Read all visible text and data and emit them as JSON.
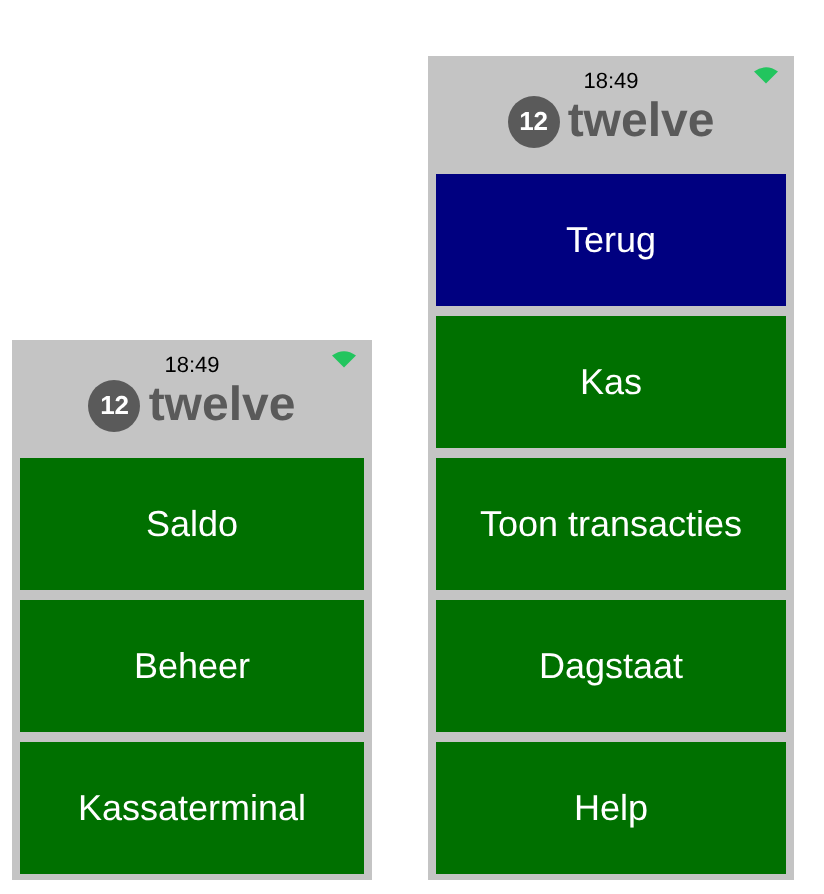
{
  "screens": [
    {
      "time": "18:49",
      "logo_mark": "12",
      "logo_text": "twelve",
      "buttons": [
        {
          "label": "Saldo",
          "kind": "menu"
        },
        {
          "label": "Beheer",
          "kind": "menu"
        },
        {
          "label": "Kassaterminal",
          "kind": "menu"
        }
      ]
    },
    {
      "time": "18:49",
      "logo_mark": "12",
      "logo_text": "twelve",
      "buttons": [
        {
          "label": "Terug",
          "kind": "back"
        },
        {
          "label": "Kas",
          "kind": "menu"
        },
        {
          "label": "Toon transacties",
          "kind": "menu"
        },
        {
          "label": "Dagstaat",
          "kind": "menu"
        },
        {
          "label": "Help",
          "kind": "menu"
        }
      ]
    }
  ]
}
